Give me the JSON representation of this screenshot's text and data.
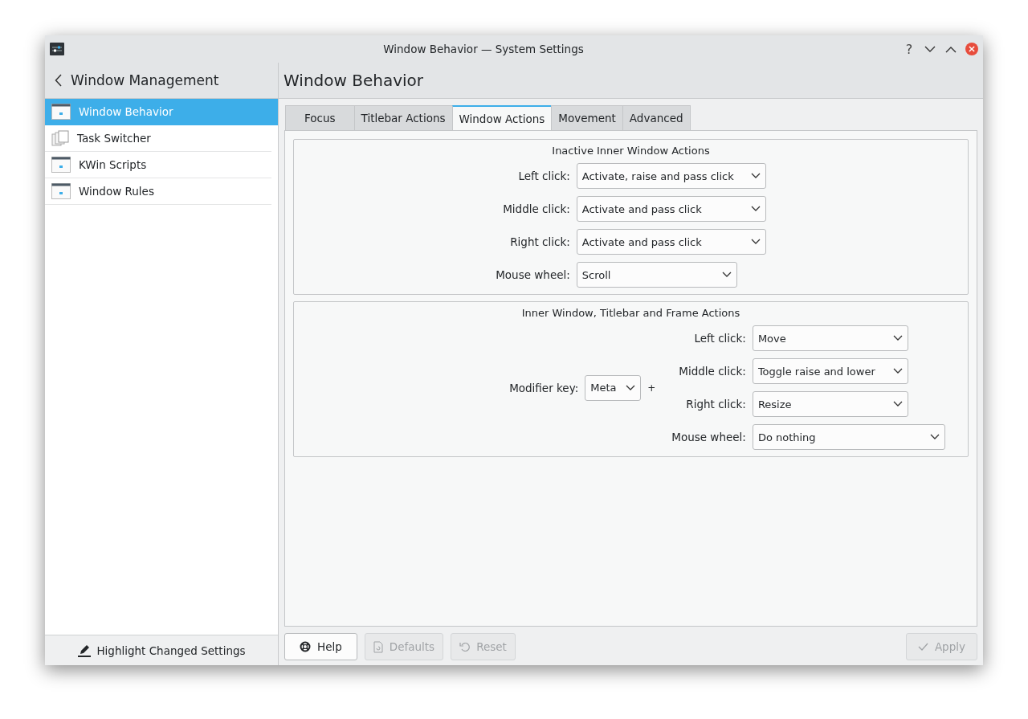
{
  "window": {
    "title": "Window Behavior — System Settings",
    "controls": [
      {
        "kind": "help",
        "label": "?"
      },
      {
        "kind": "minimize"
      },
      {
        "kind": "maximize"
      },
      {
        "kind": "close"
      }
    ]
  },
  "sidebar": {
    "back_title": "Window Management",
    "items": [
      {
        "label": "Window Behavior",
        "selected": true,
        "kind": "window"
      },
      {
        "label": "Task Switcher",
        "selected": false,
        "kind": "stack"
      },
      {
        "label": "KWin Scripts",
        "selected": false,
        "kind": "window"
      },
      {
        "label": "Window Rules",
        "selected": false,
        "kind": "window"
      }
    ],
    "footer": "Highlight Changed Settings"
  },
  "page_title": "Window Behavior",
  "tabs": [
    {
      "label": "Focus",
      "selected": false
    },
    {
      "label": "Titlebar Actions",
      "selected": false
    },
    {
      "label": "Window Actions",
      "selected": true
    },
    {
      "label": "Movement",
      "selected": false
    },
    {
      "label": "Advanced",
      "selected": false
    }
  ],
  "groups": [
    {
      "title": "Inactive Inner Window Actions",
      "kind": "simple",
      "rows": [
        {
          "label": "Left click:",
          "value": "Activate, raise and pass click"
        },
        {
          "label": "Middle click:",
          "value": "Activate and pass click"
        },
        {
          "label": "Right click:",
          "value": "Activate and pass click"
        },
        {
          "label": "Mouse wheel:",
          "value": "Scroll"
        }
      ]
    },
    {
      "title": "Inner Window, Titlebar and Frame Actions",
      "kind": "modifier",
      "modifier": {
        "label": "Modifier key:",
        "value": "Meta",
        "plus": "+"
      },
      "rows": [
        {
          "label": "Left click:",
          "value": "Move"
        },
        {
          "label": "Middle click:",
          "value": "Toggle raise and lower"
        },
        {
          "label": "Right click:",
          "value": "Resize"
        },
        {
          "label": "Mouse wheel:",
          "value": "Do nothing"
        }
      ]
    }
  ],
  "buttons": [
    {
      "kind": "help",
      "label": "Help",
      "disabled": false
    },
    {
      "kind": "defaults",
      "label": "Defaults",
      "disabled": true
    },
    {
      "kind": "reset",
      "label": "Reset",
      "disabled": true
    }
  ],
  "apply": {
    "kind": "apply",
    "label": "Apply",
    "disabled": true
  }
}
